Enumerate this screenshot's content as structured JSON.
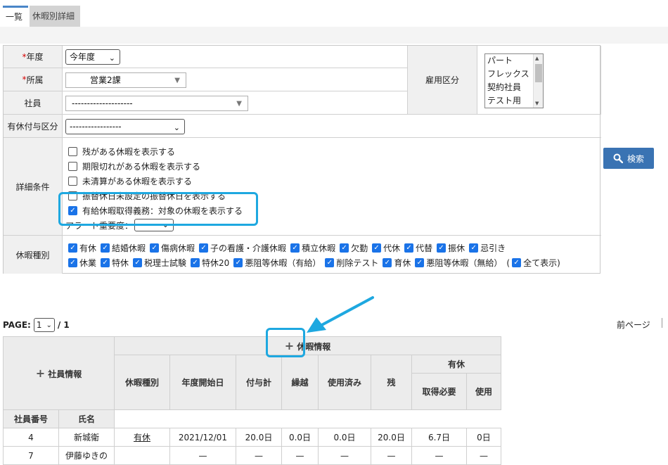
{
  "tabs": [
    {
      "label": "一覧"
    },
    {
      "label": "休暇別詳細"
    }
  ],
  "filter": {
    "year": {
      "label": "年度",
      "required": "*",
      "value": "今年度"
    },
    "dept": {
      "label": "所属",
      "required": "*",
      "value": "営業2課"
    },
    "employee": {
      "label": "社員",
      "value": "--------------------"
    },
    "grant": {
      "label": "有休付与区分",
      "value": "-----------------"
    },
    "employment": {
      "label": "雇用区分",
      "options": [
        "パート",
        "フレックス",
        "契約社員",
        "テスト用"
      ]
    },
    "detail": {
      "label": "詳細条件",
      "options": [
        {
          "label": "残がある休暇を表示する",
          "checked": false
        },
        {
          "label": "期限切れがある休暇を表示する",
          "checked": false
        },
        {
          "label": "未清算がある休暇を表示する",
          "checked": false
        },
        {
          "label": "振替休日未設定の振替休日を表示する",
          "checked": false
        },
        {
          "label": "有給休暇取得義務：対象の休暇を表示する",
          "checked": true
        }
      ],
      "alert_label": "アラート重要度："
    },
    "kinds": {
      "label": "休暇種別",
      "row1": [
        "有休",
        "結婚休暇",
        "傷病休暇",
        "子の看護・介護休暇",
        "積立休暇",
        "欠勤",
        "代休",
        "代替",
        "振休",
        "忌引き"
      ],
      "row2": [
        "休業",
        "特休",
        "税理士試験",
        "特休20",
        "悪阻等休暇（有給）",
        "削除テスト",
        "育休",
        "悪阻等休暇（無給）"
      ],
      "paren": "(",
      "show_all": "全て表示)"
    },
    "search_label": "検索"
  },
  "pager": {
    "label": "PAGE:",
    "current": "1",
    "total": "/ 1",
    "prev": "前ページ"
  },
  "table": {
    "emp_group": "社員情報",
    "leave_group": "休暇情報",
    "cols": {
      "emp_no": "社員番号",
      "name": "氏名",
      "kind": "休暇種別",
      "start": "年度開始日",
      "granted": "付与計",
      "carried": "繰越",
      "used": "使用済み",
      "remaining": "残",
      "paid_group": "有休",
      "required": "取得必要",
      "use": "使用"
    },
    "rows": [
      {
        "emp_no": "4",
        "name": "新城衛",
        "kind": "有休",
        "start": "2021/12/01",
        "granted": "20.0日",
        "carried": "0.0日",
        "used": "0.0日",
        "remaining": "20.0日",
        "required": "6.7日",
        "use": "0日"
      },
      {
        "emp_no": "7",
        "name": "伊藤ゆきの",
        "kind": "",
        "start": "—",
        "granted": "—",
        "carried": "—",
        "used": "—",
        "remaining": "—",
        "required": "—",
        "use": "—"
      }
    ]
  },
  "colors": {
    "highlight": "#1ea8e0",
    "accent": "#3a73b3",
    "check": "#1a73e8"
  }
}
